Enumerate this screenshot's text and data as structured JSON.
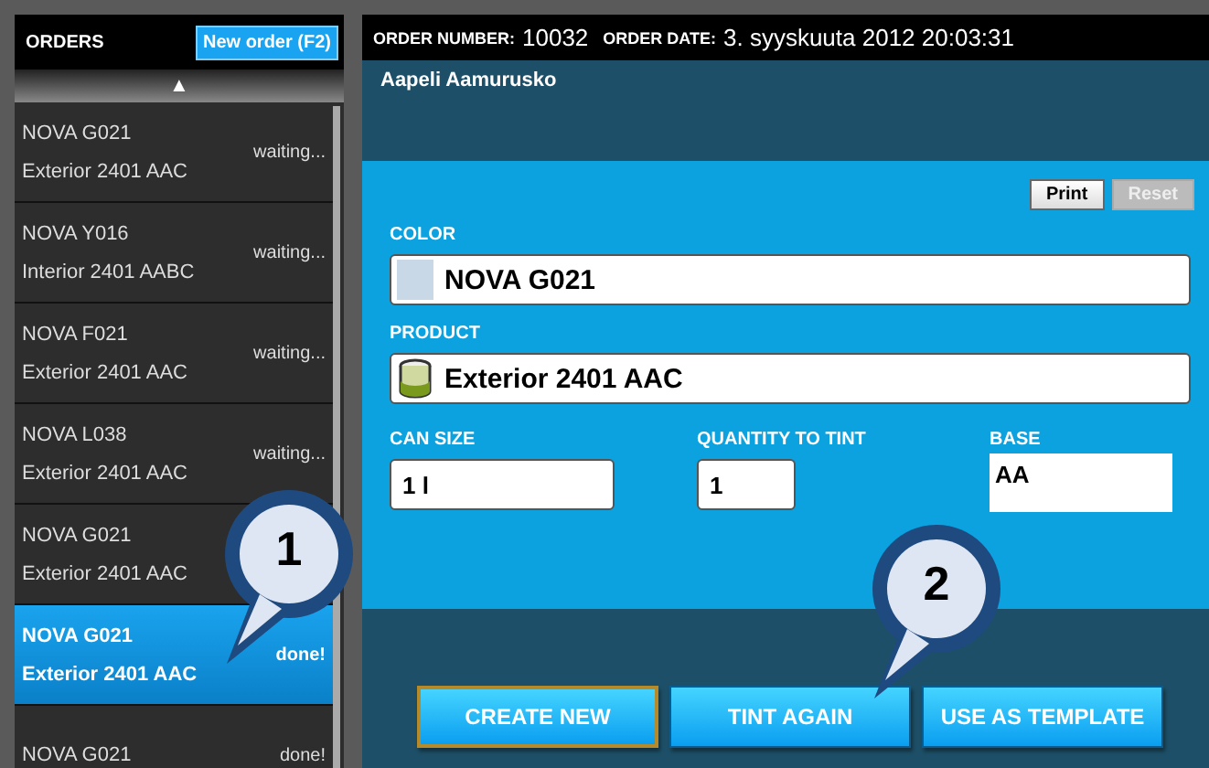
{
  "orders": {
    "title": "ORDERS",
    "new_order_button": "New order (F2)",
    "scroll_up": "▲",
    "items": [
      {
        "color_name": "NOVA G021",
        "product": "Exterior 2401 AAC",
        "status": "waiting...",
        "selected": false
      },
      {
        "color_name": "NOVA Y016",
        "product": "Interior 2401 AABC",
        "status": "waiting...",
        "selected": false
      },
      {
        "color_name": "NOVA F021",
        "product": "Exterior 2401 AAC",
        "status": "waiting...",
        "selected": false
      },
      {
        "color_name": "NOVA L038",
        "product": "Exterior 2401 AAC",
        "status": "waiting...",
        "selected": false
      },
      {
        "color_name": "NOVA G021",
        "product": "Exterior 2401 AAC",
        "selected": false
      },
      {
        "color_name": "NOVA G021",
        "product": "Exterior 2401 AAC",
        "status": "done!",
        "selected": true
      },
      {
        "color_name": "NOVA G021",
        "status": "done!",
        "selected": false
      }
    ]
  },
  "order": {
    "number_label": "ORDER NUMBER:",
    "number": "10032",
    "date_label": "ORDER DATE:",
    "date": "3. syyskuuta 2012 20:03:31",
    "customer": "Aapeli Aamurusko",
    "actions": [
      {
        "label": "Print",
        "disabled": false
      },
      {
        "label": "Reset",
        "disabled": true
      }
    ],
    "color": {
      "label": "COLOR",
      "value": "NOVA G021"
    },
    "product": {
      "label": "PRODUCT",
      "value": "Exterior 2401 AAC"
    },
    "can_size": {
      "label": "CAN SIZE",
      "value": "1 l"
    },
    "quantity": {
      "label": "QUANTITY TO TINT",
      "value": "1"
    },
    "base": {
      "label": "BASE",
      "value": "AA"
    },
    "buttons": [
      {
        "label": "CREATE NEW",
        "focused": true
      },
      {
        "label": "TINT AGAIN",
        "focused": false
      },
      {
        "label": "USE AS TEMPLATE",
        "focused": false
      }
    ]
  },
  "callouts": [
    {
      "number": "1"
    },
    {
      "number": "2"
    }
  ]
}
